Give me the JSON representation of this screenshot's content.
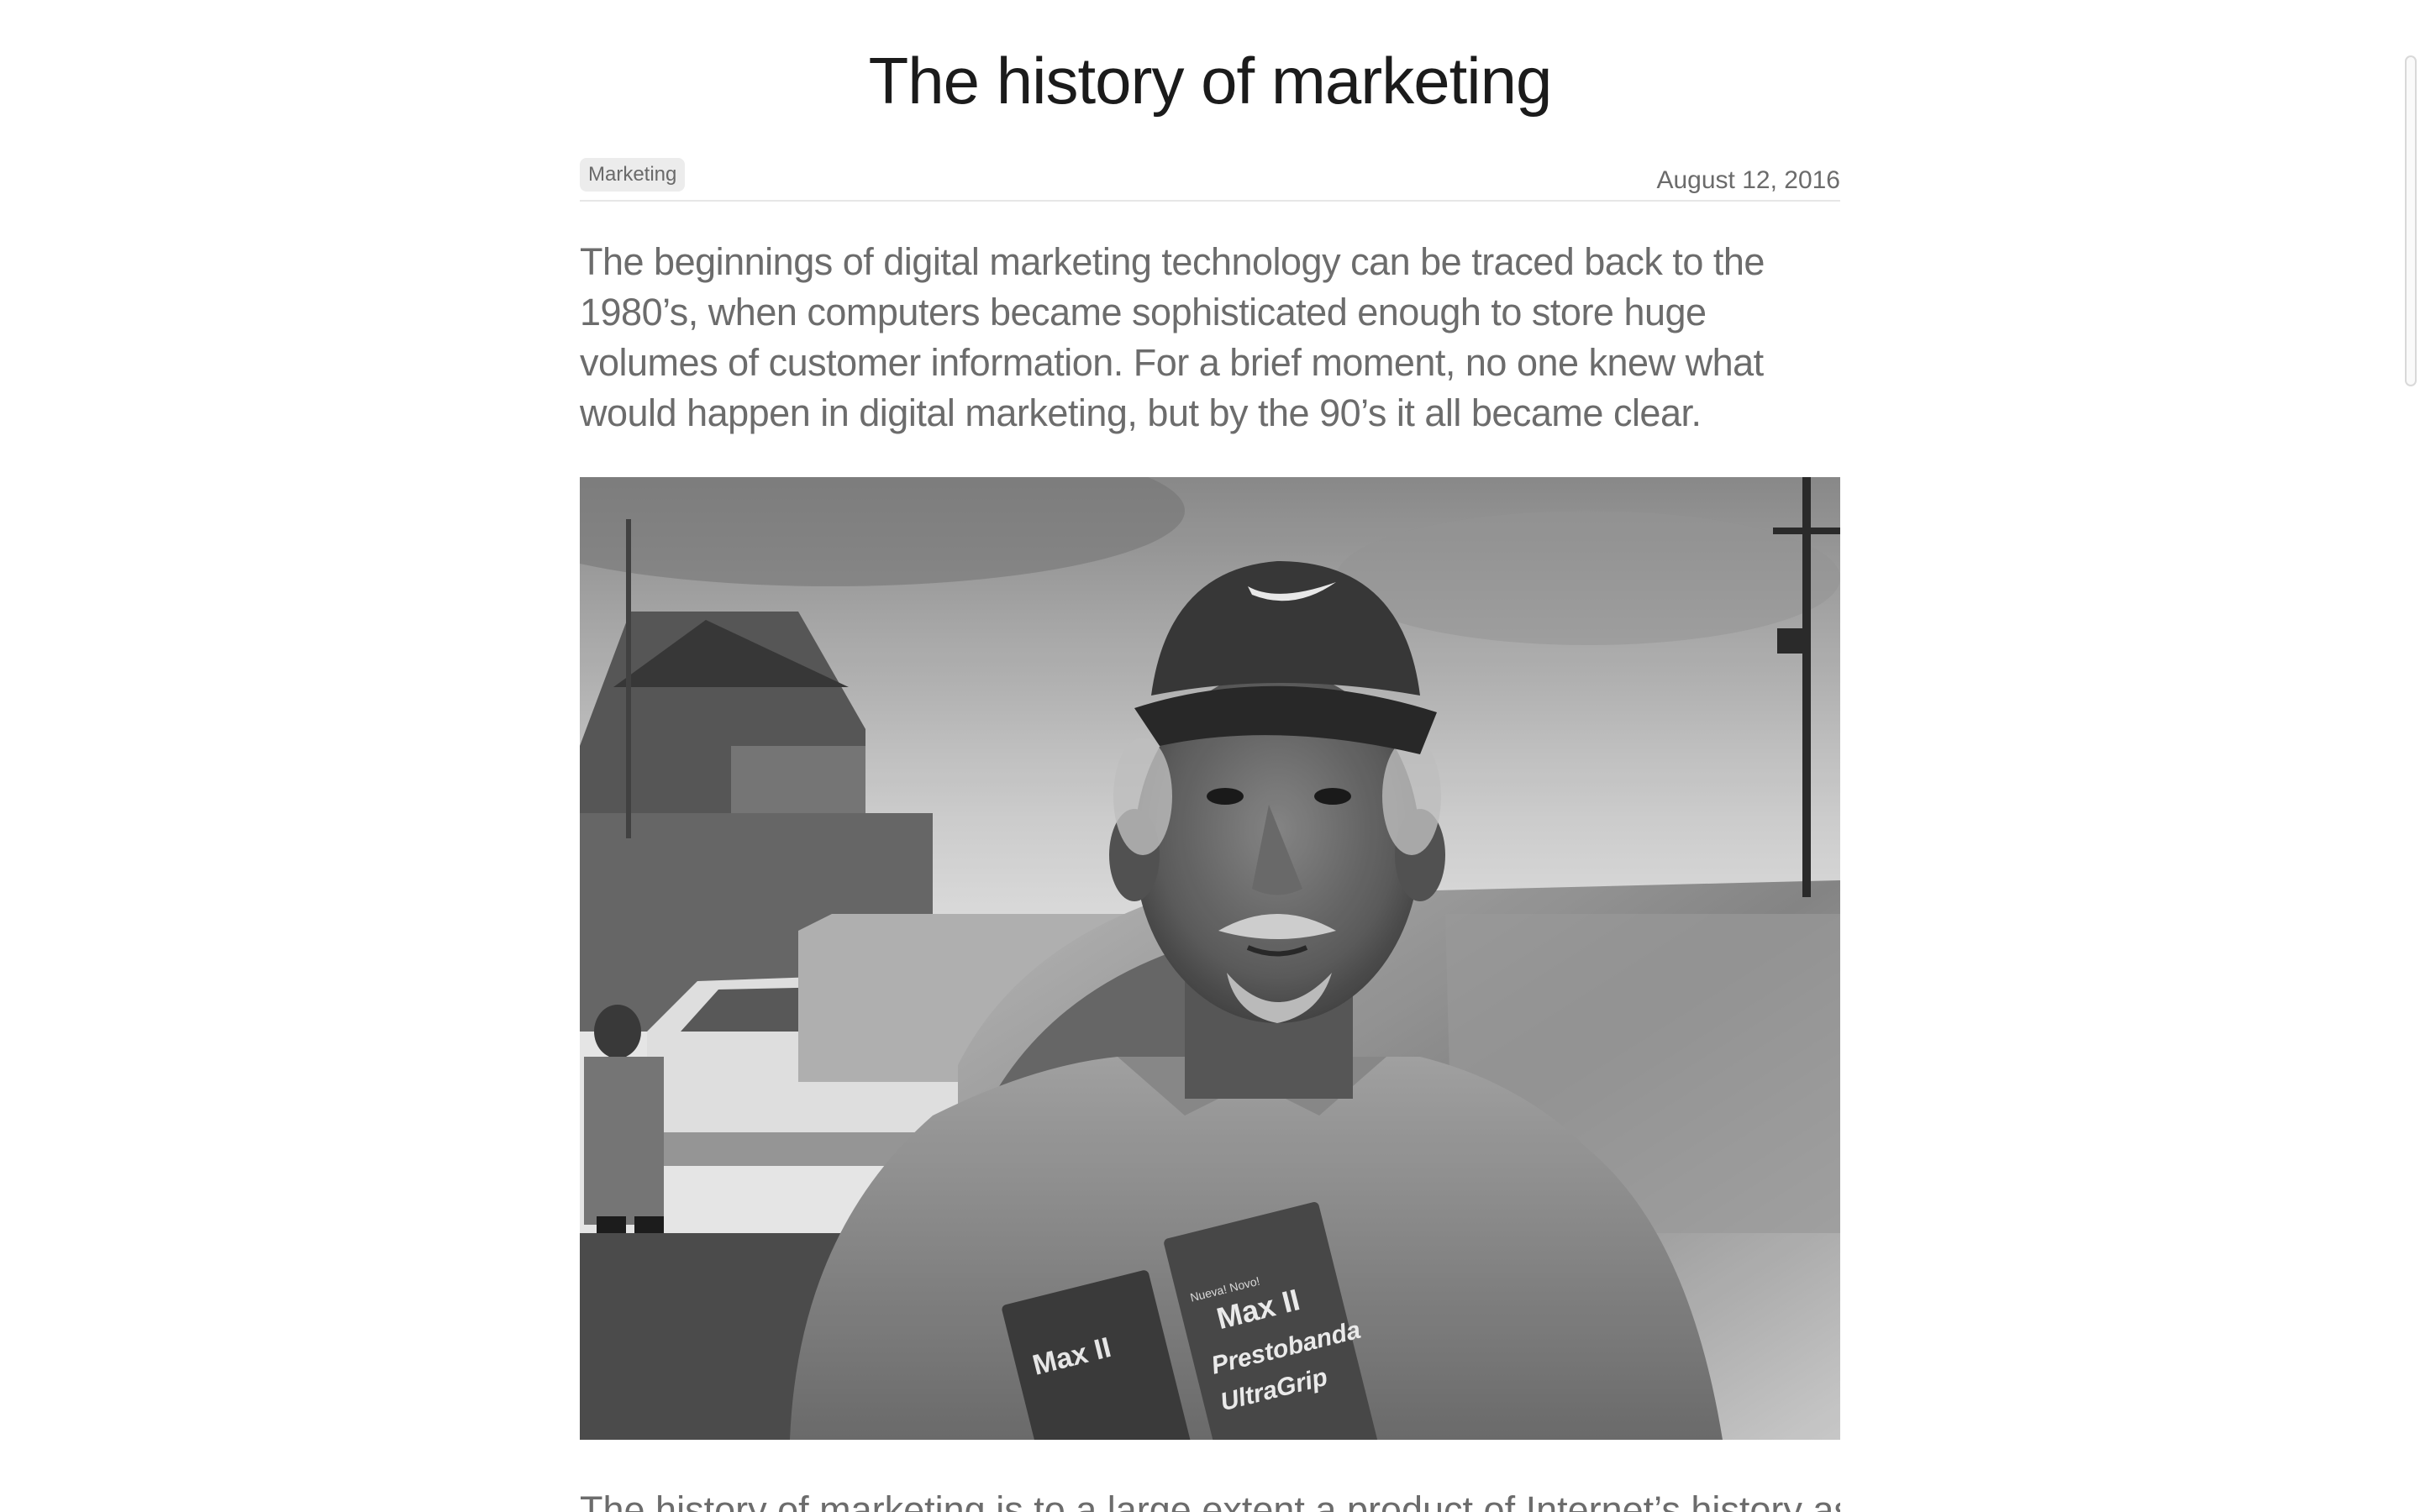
{
  "article": {
    "title": "The history of marketing",
    "category_tag": "Marketing",
    "date": "August 12, 2016",
    "lead": "The beginnings of digital marketing technology can be traced back to the 1980’s, when computers became sophisticated enough to store huge volumes of customer information. For a brief moment, no one knew what would happen in digital marketing, but by the 90’s it all became clear.",
    "body_first_line": "The history of marketing is to a large extent a product of Internet’s history as"
  },
  "photo": {
    "description_icon": "portrait-photo",
    "package_brand": "Max II",
    "package_line1": "Prestobanda",
    "package_line2": "UltraGrip",
    "package_small_label": "Nueva! Novo!"
  }
}
